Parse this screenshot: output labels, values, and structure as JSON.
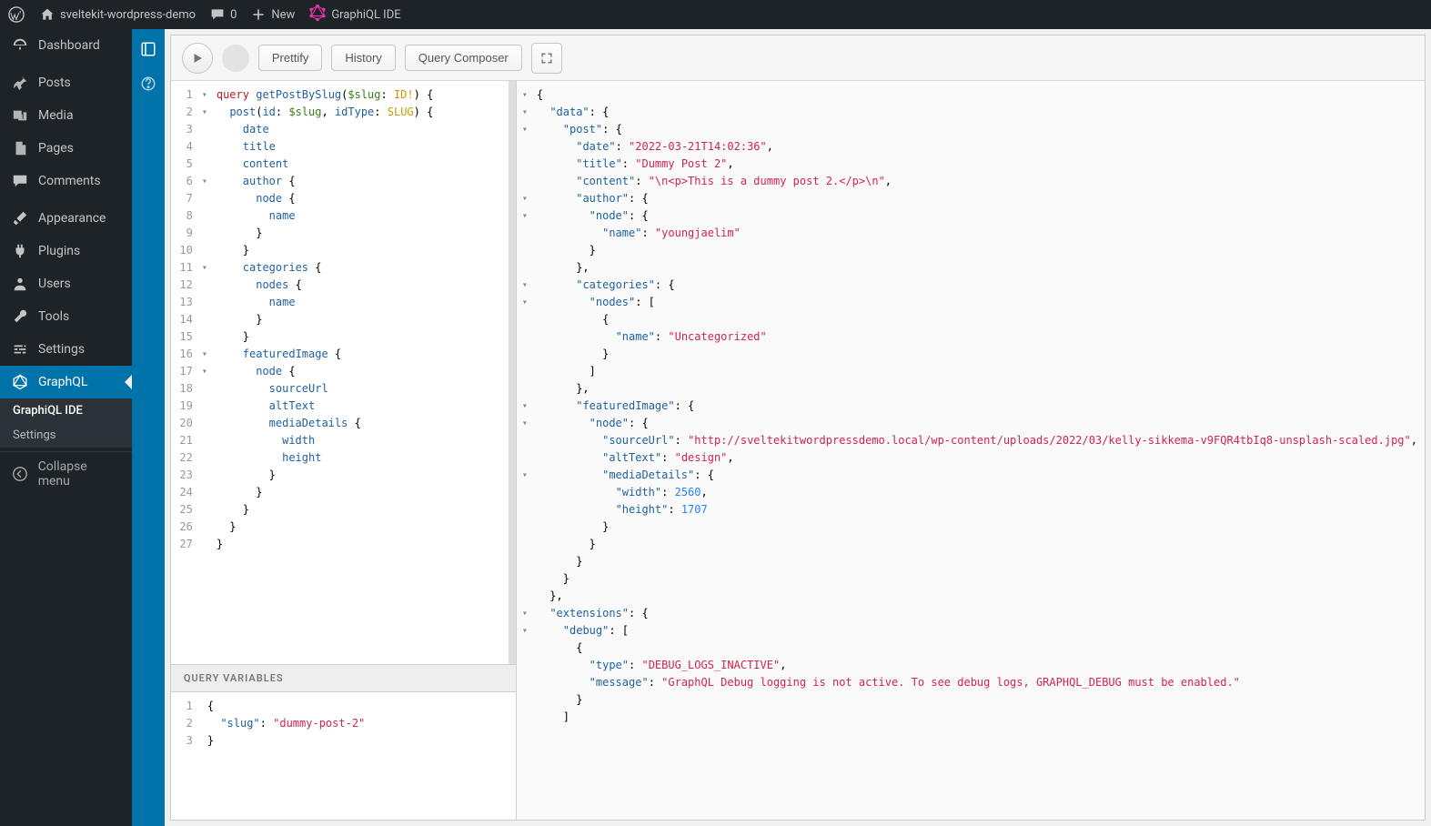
{
  "adminbar": {
    "site_name": "sveltekit-wordpress-demo",
    "comments_count": "0",
    "new_label": "New",
    "graphiql_label": "GraphiQL IDE"
  },
  "sidebar": {
    "items": [
      {
        "id": "dashboard",
        "label": "Dashboard",
        "icon": "dashboard"
      },
      {
        "id": "posts",
        "label": "Posts",
        "icon": "pin"
      },
      {
        "id": "media",
        "label": "Media",
        "icon": "media"
      },
      {
        "id": "pages",
        "label": "Pages",
        "icon": "pages"
      },
      {
        "id": "comments",
        "label": "Comments",
        "icon": "comment"
      },
      {
        "id": "appearance",
        "label": "Appearance",
        "icon": "brush"
      },
      {
        "id": "plugins",
        "label": "Plugins",
        "icon": "plug"
      },
      {
        "id": "users",
        "label": "Users",
        "icon": "user"
      },
      {
        "id": "tools",
        "label": "Tools",
        "icon": "wrench"
      },
      {
        "id": "settings",
        "label": "Settings",
        "icon": "sliders"
      },
      {
        "id": "graphql",
        "label": "GraphQL",
        "icon": "graphql"
      }
    ],
    "submenu": [
      {
        "id": "graphiql-ide",
        "label": "GraphiQL IDE"
      },
      {
        "id": "graphql-settings",
        "label": "Settings"
      }
    ],
    "collapse_label": "Collapse menu"
  },
  "toolbar": {
    "prettify": "Prettify",
    "history": "History",
    "query_composer": "Query Composer"
  },
  "query_editor": {
    "lines": [
      {
        "n": 1,
        "fold": "▾",
        "html": "<span class='kw'>query</span> <span class='def'>getPostBySlug</span>(<span class='var'>$slug</span>: <span class='atom'>ID!</span>) {"
      },
      {
        "n": 2,
        "fold": "▾",
        "html": "  <span class='prop'>post</span>(<span class='attr'>id</span>: <span class='var'>$slug</span>, <span class='attr'>idType</span>: <span class='builtin'>SLUG</span>) {"
      },
      {
        "n": 3,
        "fold": "",
        "html": "    <span class='prop'>date</span>"
      },
      {
        "n": 4,
        "fold": "",
        "html": "    <span class='prop'>title</span>"
      },
      {
        "n": 5,
        "fold": "",
        "html": "    <span class='prop'>content</span>"
      },
      {
        "n": 6,
        "fold": "▾",
        "html": "    <span class='prop'>author</span> {"
      },
      {
        "n": 7,
        "fold": "",
        "html": "      <span class='prop'>node</span> {"
      },
      {
        "n": 8,
        "fold": "",
        "html": "        <span class='prop'>name</span>"
      },
      {
        "n": 9,
        "fold": "",
        "html": "      }"
      },
      {
        "n": 10,
        "fold": "",
        "html": "    }"
      },
      {
        "n": 11,
        "fold": "▾",
        "html": "    <span class='prop'>categories</span> {"
      },
      {
        "n": 12,
        "fold": "",
        "html": "      <span class='prop'>nodes</span> {"
      },
      {
        "n": 13,
        "fold": "",
        "html": "        <span class='prop'>name</span>"
      },
      {
        "n": 14,
        "fold": "",
        "html": "      }"
      },
      {
        "n": 15,
        "fold": "",
        "html": "    }"
      },
      {
        "n": 16,
        "fold": "▾",
        "html": "    <span class='prop'>featuredImage</span> {"
      },
      {
        "n": 17,
        "fold": "▾",
        "html": "      <span class='prop'>node</span> {"
      },
      {
        "n": 18,
        "fold": "",
        "html": "        <span class='prop'>sourceUrl</span>"
      },
      {
        "n": 19,
        "fold": "",
        "html": "        <span class='prop'>altText</span>"
      },
      {
        "n": 20,
        "fold": "",
        "html": "        <span class='prop'>mediaDetails</span> {"
      },
      {
        "n": 21,
        "fold": "",
        "html": "          <span class='prop'>width</span>"
      },
      {
        "n": 22,
        "fold": "",
        "html": "          <span class='prop'>height</span>"
      },
      {
        "n": 23,
        "fold": "",
        "html": "        }"
      },
      {
        "n": 24,
        "fold": "",
        "html": "      }"
      },
      {
        "n": 25,
        "fold": "",
        "html": "    }"
      },
      {
        "n": 26,
        "fold": "",
        "html": "  }"
      },
      {
        "n": 27,
        "fold": "",
        "html": "}"
      }
    ]
  },
  "variables": {
    "header": "QUERY VARIABLES",
    "lines": [
      {
        "n": 1,
        "html": "{"
      },
      {
        "n": 2,
        "html": "  <span class='prop'>\"slug\"</span>: <span class='str'>\"dummy-post-2\"</span>"
      },
      {
        "n": 3,
        "html": "}"
      }
    ]
  },
  "result": {
    "lines": [
      {
        "fold": "▾",
        "html": "{"
      },
      {
        "fold": "▾",
        "html": "  <span class='prop'>\"data\"</span>: {"
      },
      {
        "fold": "▾",
        "html": "    <span class='prop'>\"post\"</span>: {"
      },
      {
        "fold": "",
        "html": "      <span class='prop'>\"date\"</span>: <span class='str'>\"2022-03-21T14:02:36\"</span>,"
      },
      {
        "fold": "",
        "html": "      <span class='prop'>\"title\"</span>: <span class='str'>\"Dummy Post 2\"</span>,"
      },
      {
        "fold": "",
        "html": "      <span class='prop'>\"content\"</span>: <span class='str'>\"\\n&lt;p&gt;This is a dummy post 2.&lt;/p&gt;\\n\"</span>,"
      },
      {
        "fold": "▾",
        "html": "      <span class='prop'>\"author\"</span>: {"
      },
      {
        "fold": "▾",
        "html": "        <span class='prop'>\"node\"</span>: {"
      },
      {
        "fold": "",
        "html": "          <span class='prop'>\"name\"</span>: <span class='str'>\"youngjaelim\"</span>"
      },
      {
        "fold": "",
        "html": "        }"
      },
      {
        "fold": "",
        "html": "      },"
      },
      {
        "fold": "▾",
        "html": "      <span class='prop'>\"categories\"</span>: {"
      },
      {
        "fold": "▾",
        "html": "        <span class='prop'>\"nodes\"</span>: ["
      },
      {
        "fold": "",
        "html": "          {"
      },
      {
        "fold": "",
        "html": "            <span class='prop'>\"name\"</span>: <span class='str'>\"Uncategorized\"</span>"
      },
      {
        "fold": "",
        "html": "          }"
      },
      {
        "fold": "",
        "html": "        ]"
      },
      {
        "fold": "",
        "html": "      },"
      },
      {
        "fold": "▾",
        "html": "      <span class='prop'>\"featuredImage\"</span>: {"
      },
      {
        "fold": "▾",
        "html": "        <span class='prop'>\"node\"</span>: {"
      },
      {
        "fold": "",
        "html": "          <span class='prop'>\"sourceUrl\"</span>: <span class='str'>\"http://sveltekitwordpressdemo.local/wp-content/uploads/2022/03/kelly-sikkema-v9FQR4tbIq8-unsplash-scaled.jpg\"</span>,"
      },
      {
        "fold": "",
        "html": "          <span class='prop'>\"altText\"</span>: <span class='str'>\"design\"</span>,"
      },
      {
        "fold": "▾",
        "html": "          <span class='prop'>\"mediaDetails\"</span>: {"
      },
      {
        "fold": "",
        "html": "            <span class='prop'>\"width\"</span>: <span class='num'>2560</span>,"
      },
      {
        "fold": "",
        "html": "            <span class='prop'>\"height\"</span>: <span class='num'>1707</span>"
      },
      {
        "fold": "",
        "html": "          }"
      },
      {
        "fold": "",
        "html": "        }"
      },
      {
        "fold": "",
        "html": "      }"
      },
      {
        "fold": "",
        "html": "    }"
      },
      {
        "fold": "",
        "html": "  },"
      },
      {
        "fold": "▾",
        "html": "  <span class='prop'>\"extensions\"</span>: {"
      },
      {
        "fold": "▾",
        "html": "    <span class='prop'>\"debug\"</span>: ["
      },
      {
        "fold": "",
        "html": "      {"
      },
      {
        "fold": "",
        "html": "        <span class='prop'>\"type\"</span>: <span class='str'>\"DEBUG_LOGS_INACTIVE\"</span>,"
      },
      {
        "fold": "",
        "html": "        <span class='prop'>\"message\"</span>: <span class='str'>\"GraphQL Debug logging is not active. To see debug logs, GRAPHQL_DEBUG must be enabled.\"</span>"
      },
      {
        "fold": "",
        "html": "      }"
      },
      {
        "fold": "",
        "html": "    ]"
      }
    ]
  }
}
